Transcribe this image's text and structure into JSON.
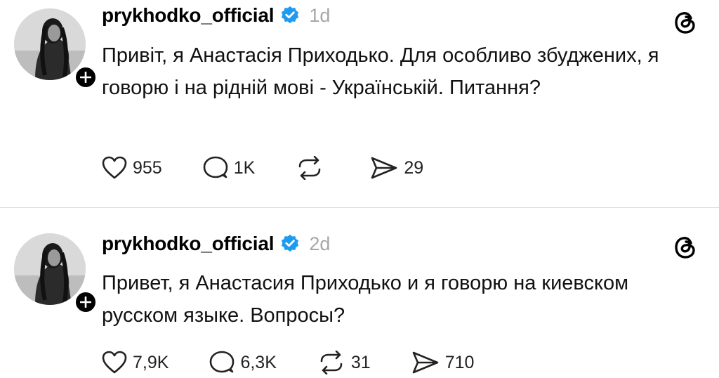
{
  "posts": [
    {
      "username": "prykhodko_official",
      "time": "1d",
      "text": "Привіт, я Анастасія Приходько. Для особливо збуджених, я говорю і на рідній мові - Українській. Питання?",
      "likes": "955",
      "replies": "1K",
      "reposts": "",
      "shares": "29"
    },
    {
      "username": "prykhodko_official",
      "time": "2d",
      "text": "Привет, я Анастасия Приходько и я говорю на киевском русском языке. Вопросы?",
      "likes": "7,9K",
      "replies": "6,3K",
      "reposts": "31",
      "shares": "710"
    }
  ],
  "icons": {
    "verified": "verified-badge-icon",
    "threads": "threads-logo-icon",
    "like": "heart-icon",
    "reply": "comment-icon",
    "repost": "repost-icon",
    "share": "send-icon",
    "follow": "plus-icon"
  },
  "colors": {
    "verified": "#1d9bf0",
    "muted": "#a6a6a6",
    "divider": "#dcdcdc"
  }
}
